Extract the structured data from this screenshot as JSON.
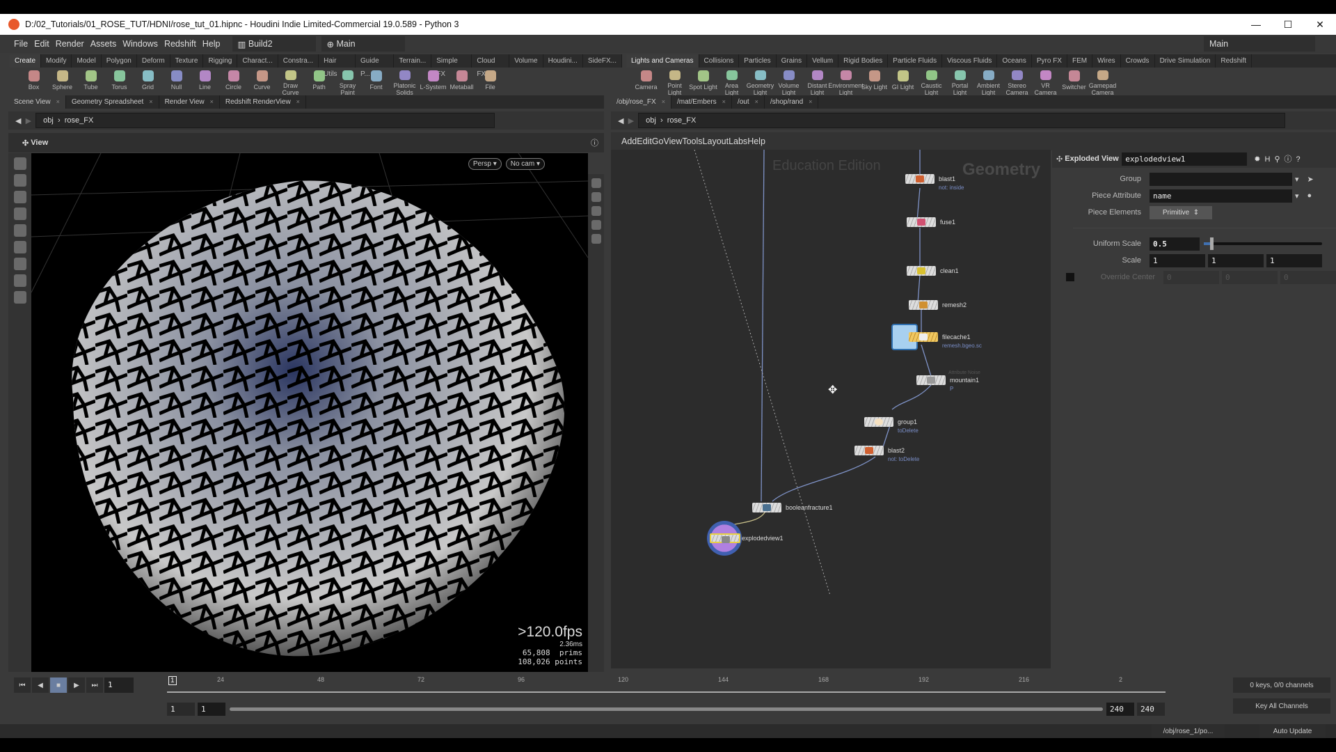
{
  "window": {
    "title": "D:/02_Tutorials/01_ROSE_TUT/HDNI/rose_tut_01.hipnc - Houdini Indie Limited-Commercial 19.0.589 - Python 3",
    "minimize": "—",
    "maximize": "☐",
    "close": "✕"
  },
  "menu": {
    "items": [
      "File",
      "Edit",
      "Render",
      "Assets",
      "Windows",
      "Redshift",
      "Help"
    ],
    "desktop": "Build2",
    "context": "Main",
    "right_desktop": "Main"
  },
  "shelf_left": {
    "tabs": [
      "Create",
      "Modify",
      "Model",
      "Polygon",
      "Deform",
      "Texture",
      "Rigging",
      "Charact...",
      "Constra...",
      "Hair Utils",
      "Guide P...",
      "Terrain...",
      "Simple FX",
      "Cloud FX",
      "Volume",
      "Houdini...",
      "SideFX..."
    ],
    "tools": [
      "Box",
      "Sphere",
      "Tube",
      "Torus",
      "Grid",
      "Null",
      "Line",
      "Circle",
      "Curve",
      "Draw Curve",
      "Path",
      "Spray Paint",
      "Font",
      "Platonic Solids",
      "L-System",
      "Metaball",
      "File"
    ]
  },
  "shelf_right": {
    "tabs": [
      "Lights and Cameras",
      "Collisions",
      "Particles",
      "Grains",
      "Vellum",
      "Rigid Bodies",
      "Particle Fluids",
      "Viscous Fluids",
      "Oceans",
      "Pyro FX",
      "FEM",
      "Wires",
      "Crowds",
      "Drive Simulation",
      "Redshift"
    ],
    "tools": [
      "Camera",
      "Point Light",
      "Spot Light",
      "Area Light",
      "Geometry Light",
      "Volume Light",
      "Distant Light",
      "Environment Light",
      "Sky Light",
      "GI Light",
      "Caustic Light",
      "Portal Light",
      "Ambient Light",
      "Stereo Camera",
      "VR Camera",
      "Switcher",
      "Gamepad Camera"
    ]
  },
  "left_pane": {
    "tabs": [
      "Scene View",
      "Geometry Spreadsheet",
      "Render View",
      "Redshift RenderView"
    ],
    "path": [
      "obj",
      "rose_FX"
    ],
    "view_label": "View",
    "persp": "Persp ▾",
    "cam": "No cam ▾",
    "stats": {
      "fps": ">120.0fps",
      "ms": "2.36ms",
      "prims": "65,808  prims",
      "points": "108,026 points"
    }
  },
  "right_pane": {
    "tabs": [
      "/obj/rose_FX",
      "/mat/Embers",
      "/out",
      "/shop/rand"
    ],
    "path": [
      "obj",
      "rose_FX"
    ],
    "menu": [
      "Add",
      "Edit",
      "Go",
      "View",
      "Tools",
      "Layout",
      "Labs",
      "Help"
    ],
    "watermark": "Education Edition",
    "context_label": "Geometry",
    "nodes": {
      "blast1": {
        "name": "blast1",
        "sub": "not: inside"
      },
      "fuse1": {
        "name": "fuse1"
      },
      "clean1": {
        "name": "clean1"
      },
      "remesh2": {
        "name": "remesh2"
      },
      "filecache1": {
        "name": "filecache1",
        "sub": "remesh.bgeo.sc"
      },
      "mountain1": {
        "name": "mountain1",
        "type": "Attribute Noise",
        "sub": "P"
      },
      "group1": {
        "name": "group1",
        "sub": "toDelete"
      },
      "blast2": {
        "name": "blast2",
        "sub": "not: toDelete"
      },
      "booleanfracture1": {
        "name": "booleanfracture1"
      },
      "explodedview1": {
        "name": "explodedview1"
      }
    }
  },
  "params": {
    "type": "Exploded View",
    "node_name": "explodedview1",
    "group": {
      "label": "Group",
      "value": ""
    },
    "piece_attribute": {
      "label": "Piece Attribute",
      "value": "name"
    },
    "piece_elements": {
      "label": "Piece Elements",
      "value": "Primitive"
    },
    "uniform_scale": {
      "label": "Uniform Scale",
      "value": "0.5",
      "slider_fraction": 0.05
    },
    "scale": {
      "label": "Scale",
      "values": [
        "1",
        "1",
        "1"
      ]
    },
    "override_center": {
      "label": "Override Center",
      "values": [
        "0",
        "0",
        "0"
      ],
      "checked": false
    }
  },
  "timeline": {
    "current_frame": "1",
    "ticks": [
      "24",
      "48",
      "72",
      "96",
      "120",
      "144",
      "168",
      "192",
      "216",
      "2"
    ],
    "frame_marker": "1",
    "range_start": "1",
    "range_start2": "1",
    "range_end": "240",
    "range_end2": "240",
    "keys": "0 keys, 0/0 channels",
    "key_all": "Key All Channels"
  },
  "status": {
    "path": "/obj/rose_1/po...",
    "update": "Auto Update"
  }
}
